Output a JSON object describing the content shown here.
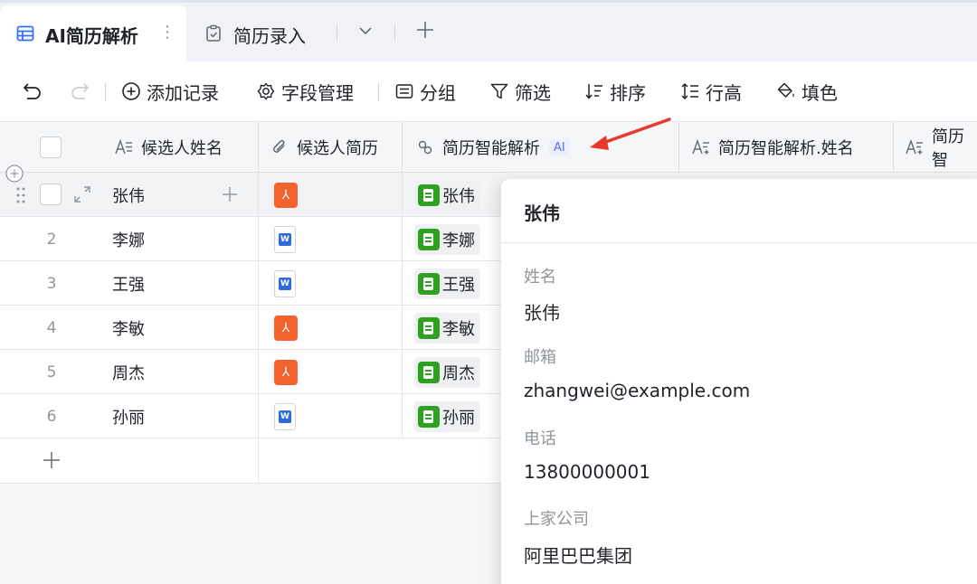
{
  "tabs": {
    "active": {
      "label": "AI简历解析",
      "more": "⋮"
    },
    "second": {
      "label": "简历录入"
    }
  },
  "toolbar": {
    "add_record": "添加记录",
    "field_manage": "字段管理",
    "group": "分组",
    "filter": "筛选",
    "sort": "排序",
    "row_height": "行高",
    "fill": "填色"
  },
  "columns": {
    "name": "候选人姓名",
    "resume": "候选人简历",
    "ai_parse": "简历智能解析",
    "ai_badge": "AI",
    "parsed_name": "简历智能解析.姓名",
    "next": "简历智"
  },
  "rows": [
    {
      "index": "",
      "name": "张伟",
      "file": "pdf",
      "parsed": "张伟"
    },
    {
      "index": "2",
      "name": "李娜",
      "file": "word",
      "parsed": "李娜"
    },
    {
      "index": "3",
      "name": "王强",
      "file": "word",
      "parsed": "王强"
    },
    {
      "index": "4",
      "name": "李敏",
      "file": "pdf",
      "parsed": "李敏"
    },
    {
      "index": "5",
      "name": "周杰",
      "file": "pdf",
      "parsed": "周杰"
    },
    {
      "index": "6",
      "name": "孙丽",
      "file": "word",
      "parsed": "孙丽"
    }
  ],
  "add_row_symbol": "+",
  "panel": {
    "title": "张伟",
    "fields": [
      {
        "label": "姓名",
        "value": "张伟"
      },
      {
        "label": "邮箱",
        "value": "zhangwei@example.com"
      },
      {
        "label": "电话",
        "value": "13800000001"
      },
      {
        "label": "上家公司",
        "value": "阿里巴巴集团"
      }
    ]
  },
  "colors": {
    "accent": "#5b6bf5",
    "pdf": "#f5622e",
    "word": "#2f6bdc",
    "ai_chip": "#2ea121",
    "arrow": "#e8372c"
  }
}
